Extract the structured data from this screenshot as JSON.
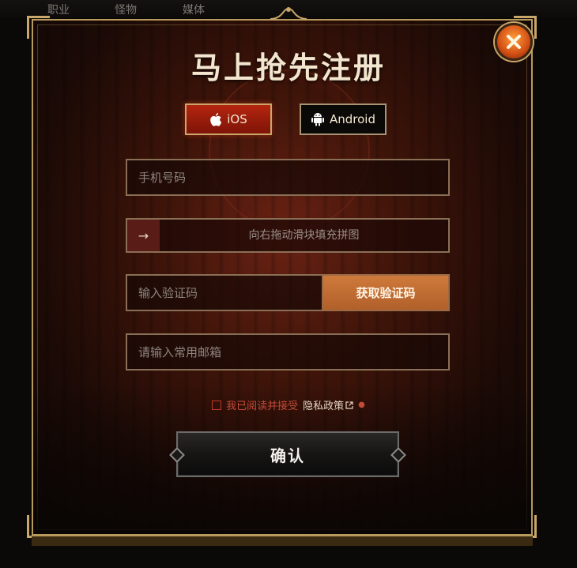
{
  "nav": {
    "items": [
      "职业",
      "怪物",
      "媒体"
    ]
  },
  "modal": {
    "title": "马上抢先注册",
    "close_icon": "close-x-icon",
    "accent_color": "#d24e14",
    "border_color": "#b89a5c"
  },
  "platforms": {
    "ios_label": "iOS",
    "android_label": "Android"
  },
  "form": {
    "phone_placeholder": "手机号码",
    "slider_text": "向右拖动滑块填充拼图",
    "slider_handle_icon": "arrow-right-icon",
    "code_placeholder": "输入验证码",
    "get_code_label": "获取验证码",
    "email_placeholder": "请输入常用邮箱"
  },
  "agreement": {
    "text": "我已阅读并接受",
    "link_label": "隐私政策",
    "link_icon": "external-link-icon"
  },
  "confirm_label": "确认"
}
